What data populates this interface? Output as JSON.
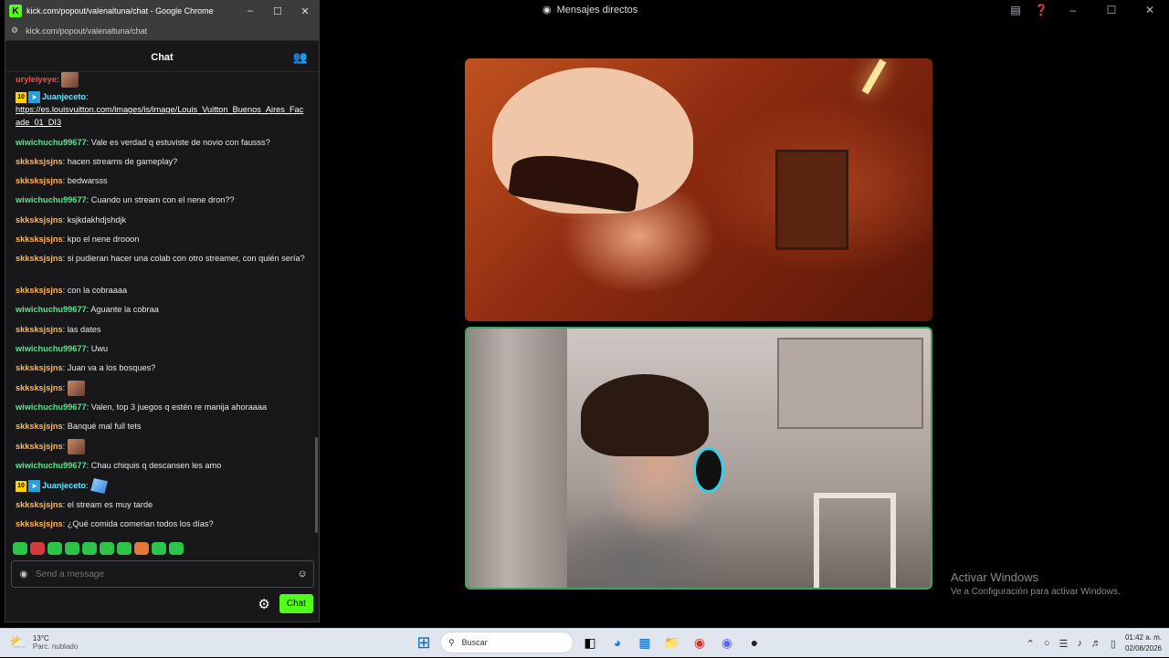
{
  "discord": {
    "title": "Mensajes directos",
    "activate": {
      "line1": "Activar Windows",
      "line2": "Ve a Configuración para activar Windows."
    }
  },
  "chrome": {
    "title": "kick.com/popout/valenaltuna/chat - Google Chrome",
    "url": "kick.com/popout/valenaltuna/chat",
    "logo_letter": "K"
  },
  "chat": {
    "header": "Chat",
    "messages": [
      {
        "user": "uryleiyeye",
        "text": ""
      },
      {
        "user": "Juanjeceto",
        "badge": "10",
        "text": ""
      },
      {
        "link": "https://es.louisvuitton.com/images/is/image/Louis_Vuitton_Buenos_Aires_Facade_01_DI3"
      },
      {
        "user": "wiwichuchu99677",
        "text": "Vale es verdad q estuviste de novio con fausss?"
      },
      {
        "user": "skksksjsjns",
        "text": "hacen streams de gameplay?"
      },
      {
        "user": "skksksjsjns",
        "text": "bedwarsss"
      },
      {
        "user": "wiwichuchu99677",
        "text": "Cuando un stream con el nene dron??"
      },
      {
        "user": "skksksjsjns",
        "text": "ksjkdakhdjshdjk"
      },
      {
        "user": "skksksjsjns",
        "text": "kpo el nene drooon"
      },
      {
        "user": "skksksjsjns",
        "text": "si pudieran hacer una colab con otro streamer, con quién sería?"
      },
      {
        "user": "skksksjsjns",
        "text": "con la cobraaaa"
      },
      {
        "user": "wiwichuchu99677",
        "text": "Aguante la cobraa"
      },
      {
        "user": "skksksjsjns",
        "text": "las dates"
      },
      {
        "user": "wiwichuchu99677",
        "text": "Uwu"
      },
      {
        "user": "skksksjsjns",
        "text": "Juan va a los bosques?"
      },
      {
        "user": "skksksjsjns",
        "text": ""
      },
      {
        "user": "wiwichuchu99677",
        "text": "Valen, top 3 juegos q estén re manija ahoraaaa"
      },
      {
        "user": "skksksjsjns",
        "text": "Banqué mal full tets"
      },
      {
        "user": "skksksjsjns",
        "text": ""
      },
      {
        "user": "wiwichuchu99677",
        "text": "Chau chiquis q descansen les amo"
      },
      {
        "user": "Juanjeceto",
        "badge": "10",
        "text": ""
      },
      {
        "user": "skksksjsjns",
        "text": "el stream es muy tarde"
      },
      {
        "user": "skksksjsjns",
        "text": "¿Qué comida comerian todos los días?"
      }
    ],
    "colon": ":",
    "placeholder": "Send a message",
    "send_label": "Chat"
  },
  "taskbar": {
    "weather_temp": "13°C",
    "weather_desc": "Parc. nublado",
    "search_placeholder": "Buscar",
    "time": "01:42 a. m.",
    "date": "02/08/2026"
  },
  "colors": {
    "kick_green": "#53fc18",
    "speaking_border": "#3ba55c"
  }
}
